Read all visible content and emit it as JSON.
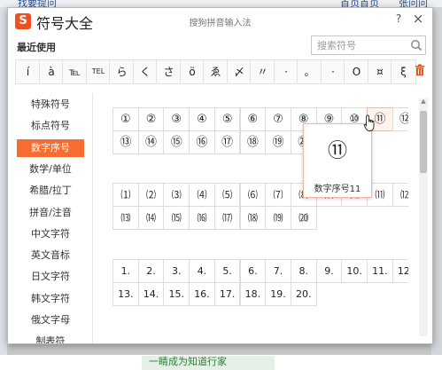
{
  "background": {
    "top_links": [
      "找要提问",
      "首页首页",
      "张问问"
    ],
    "bottom_banner_text": "一睛成为知道行家"
  },
  "titlebar": {
    "logo_char": "S",
    "app_title": "符号大全",
    "window_title": "搜狗拼音输入法",
    "help_label": "?",
    "close_label": "×"
  },
  "recent": {
    "label": "最近使用",
    "symbols": [
      "í",
      "à",
      "℡",
      "TEL",
      "ら",
      "く",
      "さ",
      "ö",
      "ゑ",
      "〆",
      "〃",
      "·",
      "。",
      "·",
      "O",
      "¤",
      "ξ"
    ]
  },
  "search": {
    "placeholder": "搜索符号"
  },
  "sidebar": {
    "items": [
      {
        "label": "特殊符号"
      },
      {
        "label": "标点符号"
      },
      {
        "label": "数字序号"
      },
      {
        "label": "数学/单位"
      },
      {
        "label": "希腊/拉丁"
      },
      {
        "label": "拼音/注音"
      },
      {
        "label": "中文字符"
      },
      {
        "label": "英文音标"
      },
      {
        "label": "日文字符"
      },
      {
        "label": "韩文字符"
      },
      {
        "label": "俄文字母"
      },
      {
        "label": "制表符"
      }
    ],
    "active_index": 2
  },
  "grid": {
    "circled": [
      "①",
      "②",
      "③",
      "④",
      "⑤",
      "⑥",
      "⑦",
      "⑧",
      "⑨",
      "⑩",
      "⑪",
      "⑫",
      "⑬",
      "⑭",
      "⑮",
      "⑯",
      "⑰",
      "⑱",
      "⑲",
      "⑳"
    ],
    "parenthesized": [
      "⑴",
      "⑵",
      "⑶",
      "⑷",
      "⑸",
      "⑹",
      "⑺",
      "⑻",
      "⑼",
      "⑽",
      "⑾",
      "⑿",
      "⒀",
      "⒁",
      "⒂",
      "⒃",
      "⒄",
      "⒅",
      "⒆",
      "⒇"
    ],
    "period": [
      "1.",
      "2.",
      "3.",
      "4.",
      "5.",
      "6.",
      "7.",
      "8.",
      "9.",
      "10.",
      "11.",
      "12.",
      "13.",
      "14.",
      "15.",
      "16.",
      "17.",
      "18.",
      "19.",
      "20."
    ],
    "hover_index": 10
  },
  "preview": {
    "symbol": "⑪",
    "caption": "数字序号11"
  },
  "colors": {
    "accent": "#f76c2f",
    "logo": "#f04f20",
    "hover_border": "#f3b79a"
  }
}
